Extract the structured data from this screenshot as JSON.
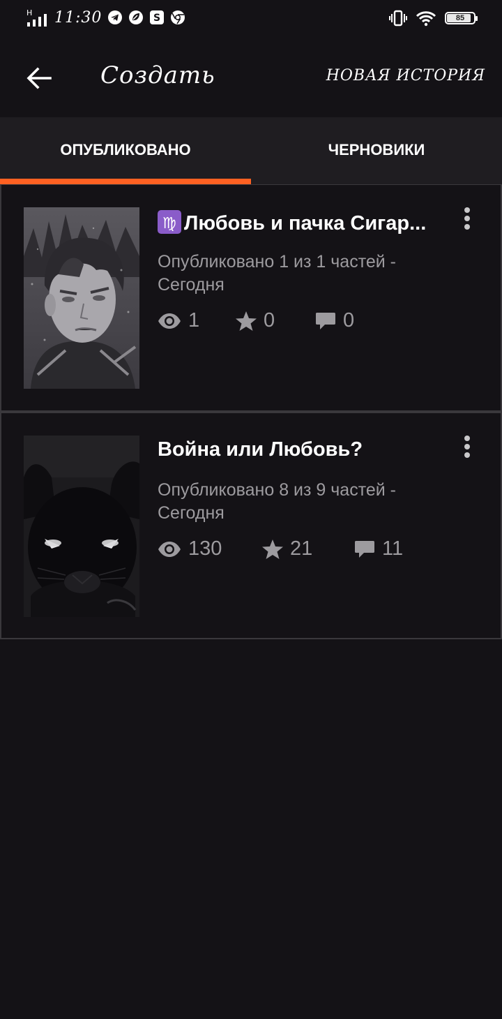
{
  "status_bar": {
    "network": "H",
    "time": "11:30",
    "battery": "85",
    "battery_level": 0.85
  },
  "header": {
    "back_icon": "arrow-left-icon",
    "title": "Создать",
    "new_story_label": "НОВАЯ ИСТОРИЯ"
  },
  "tabs": [
    {
      "label": "ОПУБЛИКОВАНО",
      "active": true
    },
    {
      "label": "ЧЕРНОВИКИ",
      "active": false
    }
  ],
  "accent_color": "#ff6122",
  "stories": [
    {
      "title": "Любовь и пачка Сигар...",
      "title_emoji": "♍",
      "meta": "Опубликовано 1 из 1 частей - Сегодня",
      "views": "1",
      "stars": "0",
      "comments": "0",
      "cover_icon": "portrait-boy-cover"
    },
    {
      "title": "Война или Любовь?",
      "meta": "Опубликовано 8 из 9 частей - Сегодня",
      "views": "130",
      "stars": "21",
      "comments": "11",
      "cover_icon": "black-cat-cover"
    }
  ]
}
